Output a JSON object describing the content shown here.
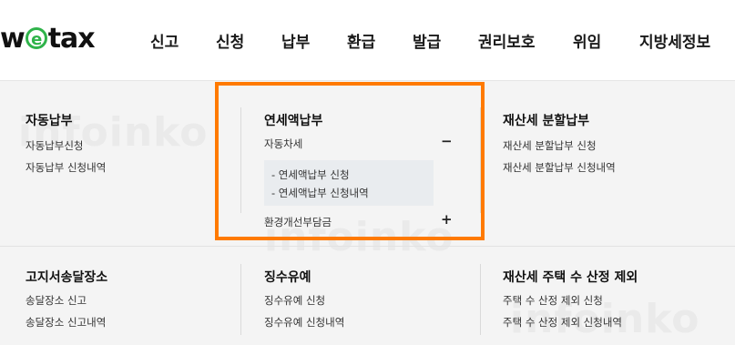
{
  "logo": {
    "prefix": "w",
    "e_letter": "e",
    "suffix": "tax"
  },
  "nav": [
    "신고",
    "신청",
    "납부",
    "환급",
    "발급",
    "권리보호",
    "위임",
    "지방세정보"
  ],
  "sections": {
    "auto_pay": {
      "title": "자동납부",
      "links": [
        "자동납부신청",
        "자동납부 신청내역"
      ]
    },
    "annual_prepay": {
      "title": "연세액납부",
      "car_tax": {
        "label": "자동차세",
        "toggle": "−"
      },
      "sub_links": [
        "- 연세액납부 신청",
        "- 연세액납부 신청내역"
      ],
      "env_charge": {
        "label": "환경개선부담금",
        "toggle": "+"
      }
    },
    "property_split": {
      "title": "재산세 분할납부",
      "links": [
        "재산세 분할납부 신청",
        "재산세 분할납부 신청내역"
      ]
    },
    "notice_place": {
      "title": "고지서송달장소",
      "links": [
        "송달장소 신고",
        "송달장소 신고내역"
      ]
    },
    "deferral": {
      "title": "징수유예",
      "links": [
        "징수유예 신청",
        "징수유예 신청내역"
      ]
    },
    "house_count": {
      "title": "재산세 주택 수 산정 제외",
      "links": [
        "주택 수 산정 제외 신청",
        "주택 수 산정 제외 신청내역"
      ]
    }
  },
  "watermark": "infoinko",
  "colors": {
    "highlight": "#ff7a00",
    "logo_green": "#2fb34a"
  }
}
